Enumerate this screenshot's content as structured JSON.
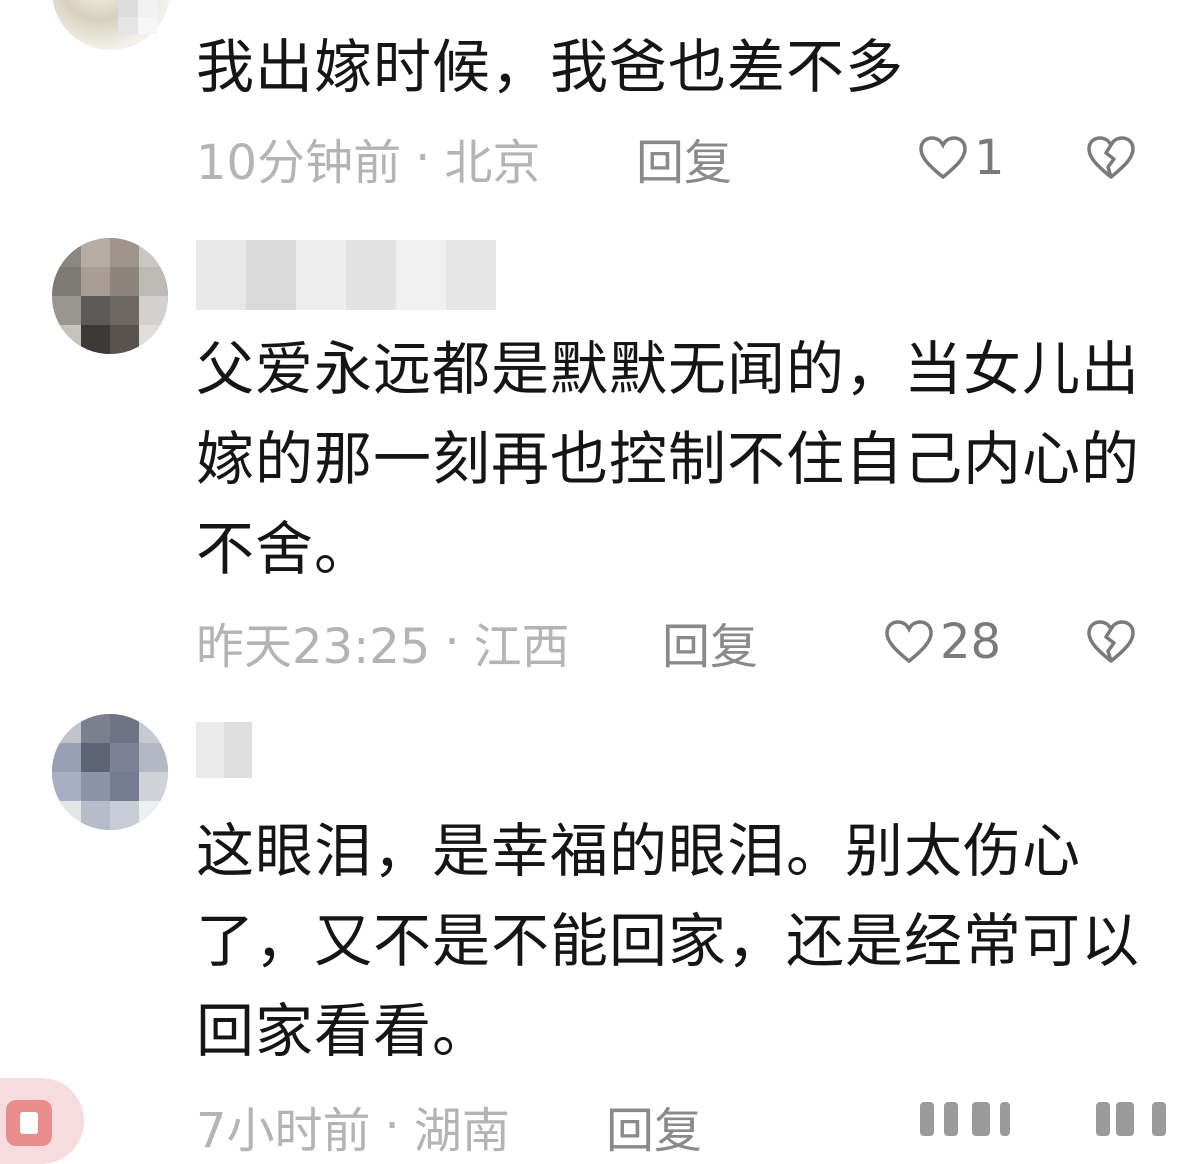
{
  "comments": [
    {
      "text": "我出嫁时候，我爸也差不多",
      "time": "10分钟前",
      "location": "北京",
      "reply_label": "回复",
      "likes": "1"
    },
    {
      "text": "父爱永远都是默默无闻的，当女儿出嫁的那一刻再也控制不住自己内心的不舍。",
      "time": "昨天23:25",
      "location": "江西",
      "reply_label": "回复",
      "likes": "28"
    },
    {
      "text": "这眼泪，是幸福的眼泪。别太伤心了，又不是不能回家，还是经常可以回家看看。",
      "time": "7小时前",
      "location": "湖南",
      "reply_label": "回复"
    }
  ],
  "separator": "·",
  "icons": {
    "like": "heart-outline-icon",
    "dislike": "broken-heart-icon",
    "float": "video-float-icon"
  },
  "colors": {
    "text": "#151515",
    "meta": "#b4b4b4",
    "reply": "#8a8a8a",
    "icon": "#8a8a8a"
  }
}
